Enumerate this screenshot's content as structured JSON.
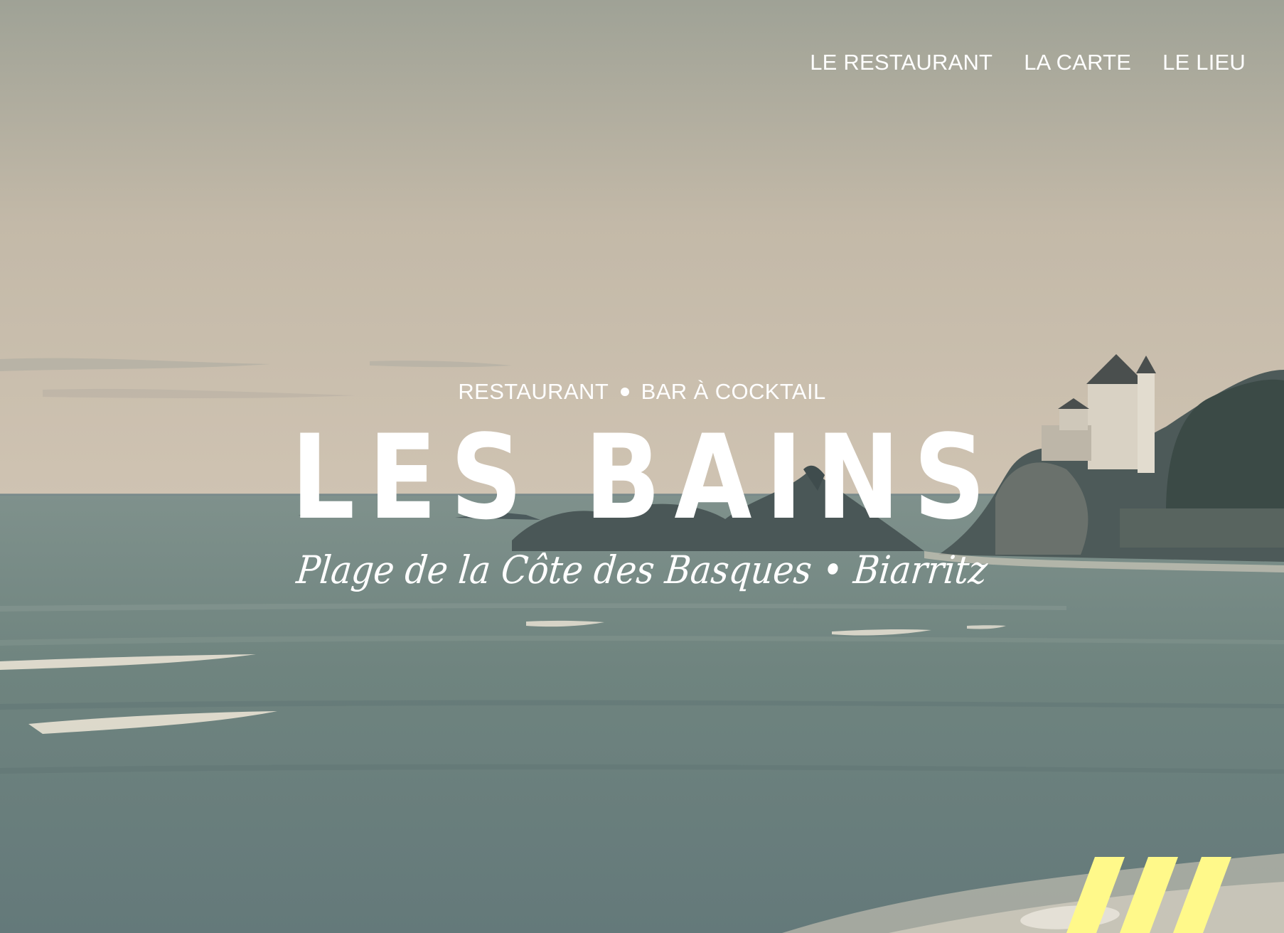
{
  "nav": {
    "items": [
      {
        "label": "LE RESTAURANT"
      },
      {
        "label": "LA CARTE"
      },
      {
        "label": "LE LIEU"
      }
    ]
  },
  "hero": {
    "tagline_left": "RESTAURANT",
    "tagline_right": "BAR À COCKTAIL",
    "title": "LES BAINS",
    "subtitle": "Plage de la Côte des Basques • Biarritz"
  },
  "colors": {
    "accent_stripes": "#fff98a",
    "text": "#ffffff"
  }
}
